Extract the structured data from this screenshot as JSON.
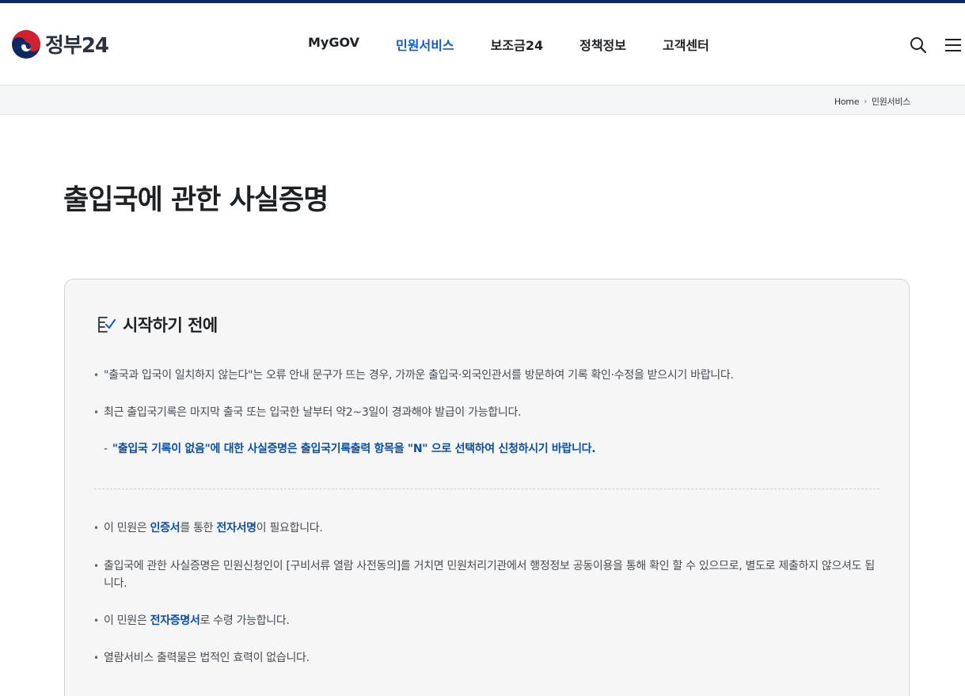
{
  "header": {
    "logo_text": "정부24",
    "nav": [
      "MyGOV",
      "민원서비스",
      "보조금24",
      "정책정보",
      "고객센터"
    ],
    "active_index": 1
  },
  "breadcrumb": {
    "home": "Home",
    "current": "민원서비스"
  },
  "page_title": "출입국에 관한 사실증명",
  "notice": {
    "title": "시작하기 전에",
    "items": [
      "\"출국과 입국이 일치하지 않는다\"는 오류 안내 문구가 뜨는 경우, 가까운 출입국·외국인관서를 방문하여 기록 확인·수정을 받으시기 바랍니다.",
      "최근 출입국기록은 마지막 출국 또는 입국한 날부터 약2~3일이 경과해야 발급이 가능합니다."
    ],
    "sub_dash": "-",
    "sub_note": "\"출입국 기록이 없음\"에 대한 사실증명은 출입국기록출력 항목을 \"N\" 으로 선택하여 신청하시기 바랍니다.",
    "item3": {
      "prefix": "이 민원은 ",
      "hl1": "인증서",
      "mid": "를 통한 ",
      "hl2": "전자서명",
      "suffix": "이 필요합니다."
    },
    "item4": "출입국에 관한 사실증명은 민원신청인이 [구비서류 열람 사전동의]를 거치면 민원처리기관에서 행정정보 공동이용을 통해 확인 할 수 있으므로, 별도로 제출하지 않으셔도 됩니다.",
    "item5": {
      "prefix": "이 민원은 ",
      "hl": "전자증명서",
      "suffix": "로 수령 가능합니다."
    },
    "item6": "열람서비스 출력물은 법적인 효력이 없습니다."
  },
  "colors": {
    "brand_navy": "#0b2a63",
    "accent_blue": "#0b5fc2",
    "highlight_blue": "#0b4ea2"
  },
  "icons": {
    "logo": "taegeuk-logo-icon",
    "search": "search-icon",
    "menu": "hamburger-menu-icon",
    "breadcrumb_sep": "chevron-right-icon",
    "notice": "checklist-icon"
  }
}
